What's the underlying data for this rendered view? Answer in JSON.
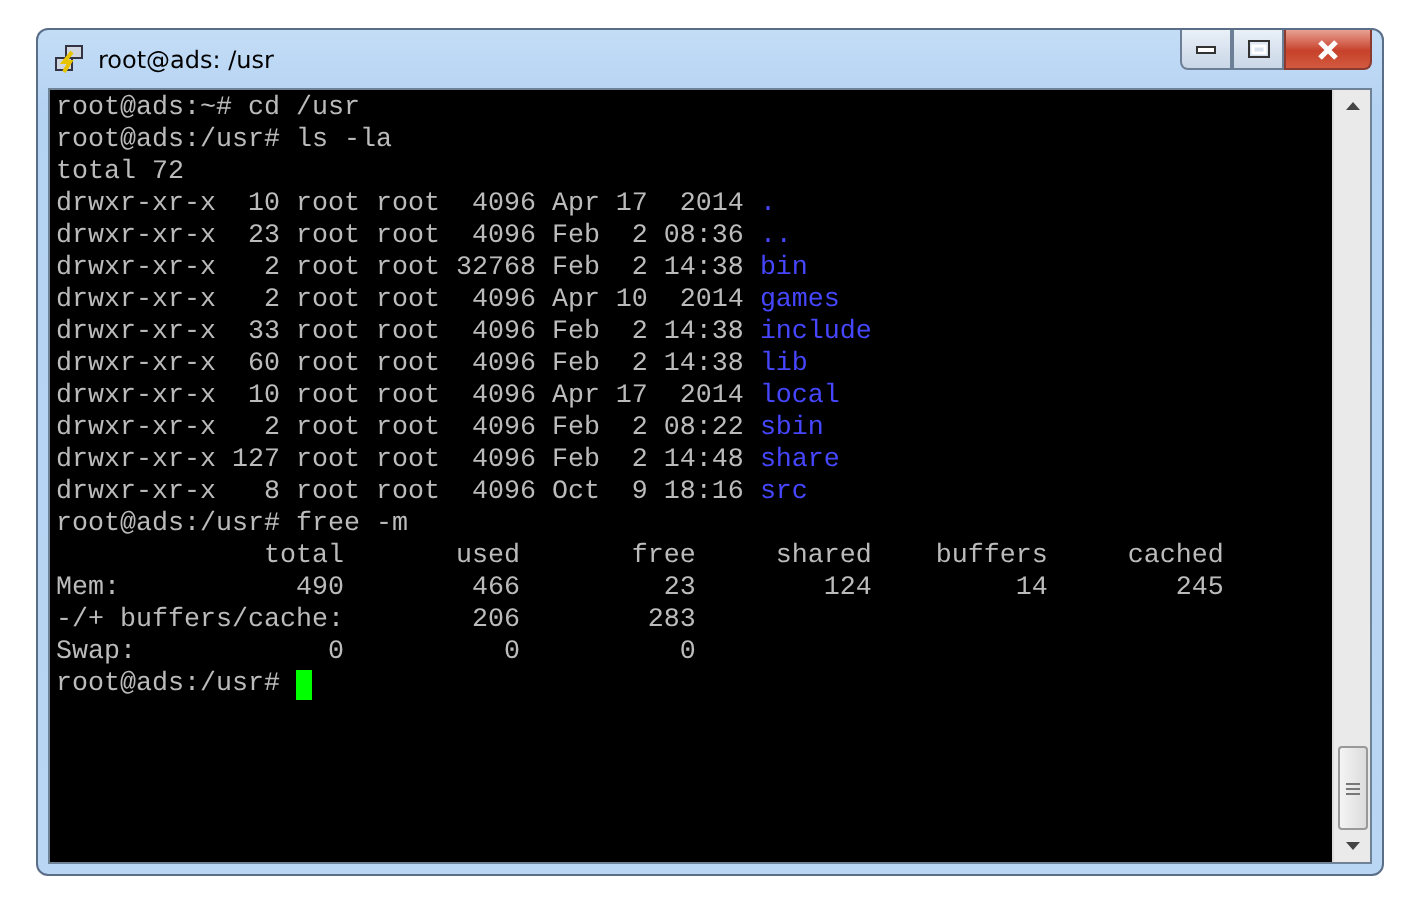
{
  "window": {
    "title": "root@ads: /usr"
  },
  "terminal": {
    "lines": [
      {
        "kind": "plain",
        "text": "root@ads:~# cd /usr"
      },
      {
        "kind": "plain",
        "text": "root@ads:/usr# ls -la"
      },
      {
        "kind": "plain",
        "text": "total 72"
      },
      {
        "kind": "entry",
        "info": "drwxr-xr-x  10 root root  4096 Apr 17  2014",
        "name": "."
      },
      {
        "kind": "entry",
        "info": "drwxr-xr-x  23 root root  4096 Feb  2 08:36",
        "name": ".."
      },
      {
        "kind": "entry",
        "info": "drwxr-xr-x   2 root root 32768 Feb  2 14:38",
        "name": "bin"
      },
      {
        "kind": "entry",
        "info": "drwxr-xr-x   2 root root  4096 Apr 10  2014",
        "name": "games"
      },
      {
        "kind": "entry",
        "info": "drwxr-xr-x  33 root root  4096 Feb  2 14:38",
        "name": "include"
      },
      {
        "kind": "entry",
        "info": "drwxr-xr-x  60 root root  4096 Feb  2 14:38",
        "name": "lib"
      },
      {
        "kind": "entry",
        "info": "drwxr-xr-x  10 root root  4096 Apr 17  2014",
        "name": "local"
      },
      {
        "kind": "entry",
        "info": "drwxr-xr-x   2 root root  4096 Feb  2 08:22",
        "name": "sbin"
      },
      {
        "kind": "entry",
        "info": "drwxr-xr-x 127 root root  4096 Feb  2 14:48",
        "name": "share"
      },
      {
        "kind": "entry",
        "info": "drwxr-xr-x   8 root root  4096 Oct  9 18:16",
        "name": "src"
      },
      {
        "kind": "plain",
        "text": "root@ads:/usr# free -m"
      },
      {
        "kind": "plain",
        "text": "             total       used       free     shared    buffers     cached"
      },
      {
        "kind": "plain",
        "text": "Mem:           490        466         23        124         14        245"
      },
      {
        "kind": "plain",
        "text": "-/+ buffers/cache:        206        283"
      },
      {
        "kind": "plain",
        "text": "Swap:            0          0          0"
      },
      {
        "kind": "prompt",
        "text": "root@ads:/usr# "
      }
    ]
  }
}
